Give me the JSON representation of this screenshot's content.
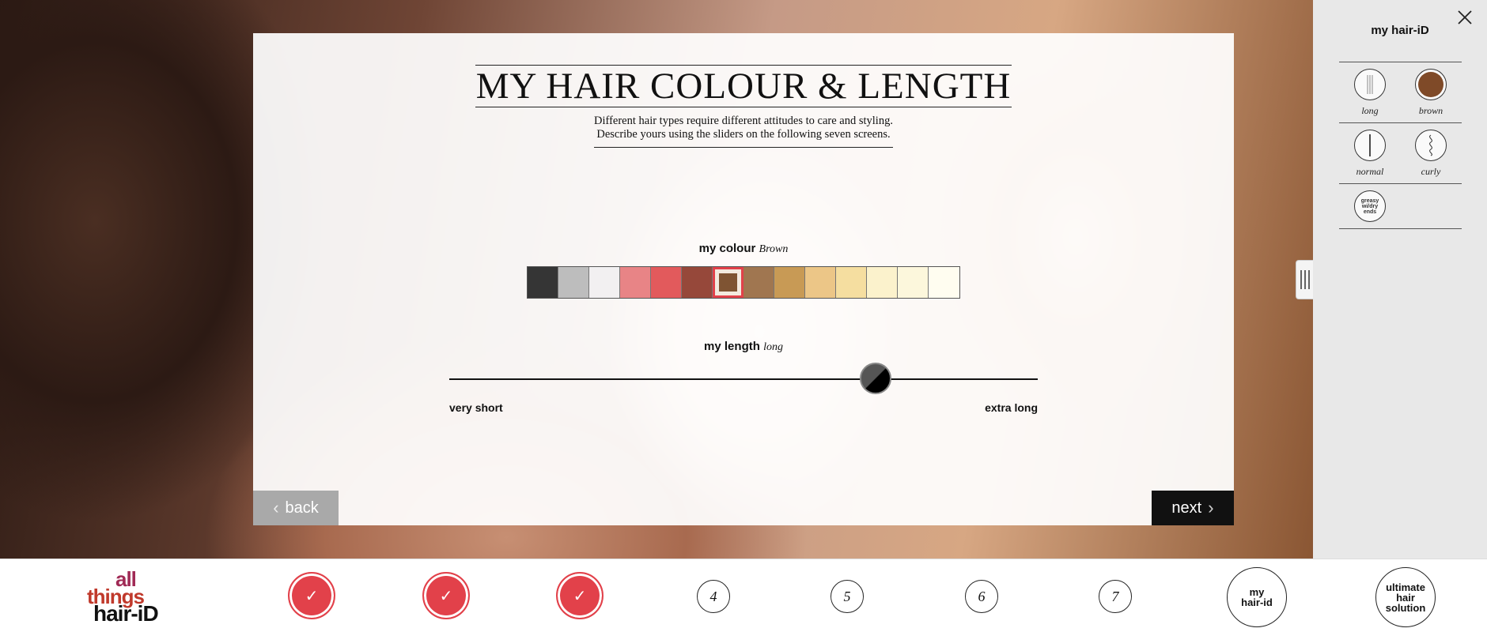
{
  "page": {
    "title": "MY HAIR COLOUR & LENGTH",
    "subtitle_line1": "Different hair types require different attitudes to care and styling.",
    "subtitle_line2": "Describe yours using the sliders on the following seven screens."
  },
  "colour": {
    "label": "my colour",
    "value": "Brown",
    "swatches": [
      "#353535",
      "#bdbdbd",
      "#f2f0f1",
      "#e88486",
      "#e25a5c",
      "#96483a",
      "#e0414a",
      "#a07650",
      "#c89a55",
      "#ecc687",
      "#f5dea0",
      "#fbf2cc",
      "#fcf7dc",
      "#fffdf0"
    ],
    "selected_index": 6,
    "selected_inner": "#7f5433"
  },
  "length": {
    "label": "my length",
    "value": "long",
    "min_label": "very short",
    "max_label": "extra long",
    "position": 0.72
  },
  "nav": {
    "back_label": "back",
    "next_label": "next"
  },
  "sidebar": {
    "title": "my hair-iD",
    "items": [
      {
        "label": "long"
      },
      {
        "label": "brown",
        "color": "#7f4a28"
      },
      {
        "label": "normal"
      },
      {
        "label": "curly"
      },
      {
        "label": "greasy wi/dry ends"
      }
    ]
  },
  "bottombar": {
    "logo_line1": "all",
    "logo_line2": "things",
    "logo_line3": "hair-iD",
    "steps": [
      "✓",
      "✓",
      "✓",
      "4",
      "5",
      "6",
      "7"
    ],
    "my_hair_id": "my hair-id",
    "ultimate": "ultimate hair solution"
  },
  "colors": {
    "accent_red": "#e2414a",
    "sidebar_bg": "#e8e8e8"
  }
}
